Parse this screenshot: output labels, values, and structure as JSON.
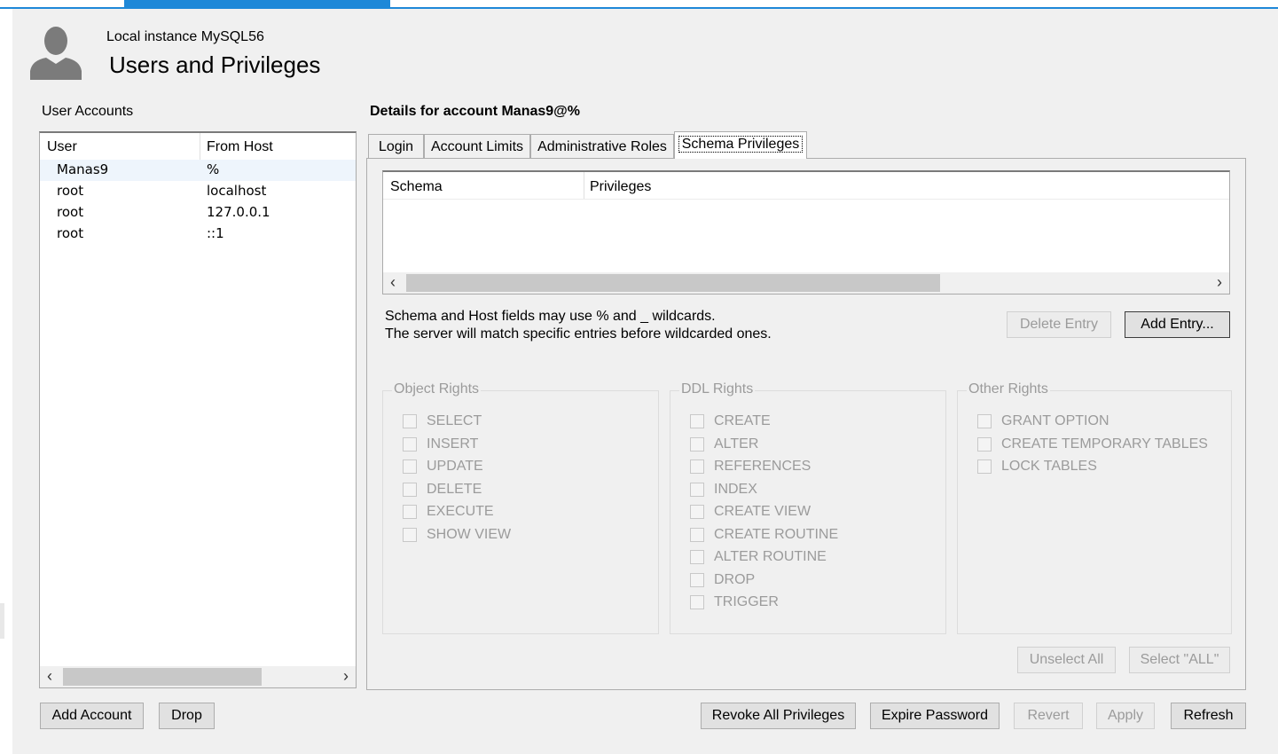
{
  "header": {
    "subtitle": "Local instance MySQL56",
    "title": "Users and Privileges"
  },
  "user_accounts": {
    "label": "User Accounts",
    "columns": [
      "User",
      "From Host"
    ],
    "rows": [
      {
        "user": "Manas9",
        "host": "%",
        "selected": true
      },
      {
        "user": "root",
        "host": "localhost"
      },
      {
        "user": "root",
        "host": "127.0.0.1"
      },
      {
        "user": "root",
        "host": "::1"
      }
    ]
  },
  "details": {
    "label": "Details for account Manas9@%",
    "tabs": [
      "Login",
      "Account Limits",
      "Administrative Roles",
      "Schema Privileges"
    ],
    "active_tab": "Schema Privileges"
  },
  "schema_privileges": {
    "columns": [
      "Schema",
      "Privileges"
    ],
    "help_line1": "Schema and Host fields may use % and _ wildcards.",
    "help_line2": "The server will match specific entries before wildcarded ones.",
    "delete_entry": "Delete Entry",
    "add_entry": "Add Entry...",
    "object_rights": {
      "label": "Object Rights",
      "items": [
        "SELECT",
        "INSERT",
        "UPDATE",
        "DELETE",
        "EXECUTE",
        "SHOW VIEW"
      ]
    },
    "ddl_rights": {
      "label": "DDL Rights",
      "items": [
        "CREATE",
        "ALTER",
        "REFERENCES",
        "INDEX",
        "CREATE VIEW",
        "CREATE ROUTINE",
        "ALTER ROUTINE",
        "DROP",
        "TRIGGER"
      ]
    },
    "other_rights": {
      "label": "Other Rights",
      "items": [
        "GRANT OPTION",
        "CREATE TEMPORARY TABLES",
        "LOCK TABLES"
      ]
    },
    "unselect_all": "Unselect All",
    "select_all": "Select \"ALL\""
  },
  "footer": {
    "add_account": "Add Account",
    "drop": "Drop",
    "revoke_all": "Revoke All Privileges",
    "expire_password": "Expire Password",
    "revert": "Revert",
    "apply": "Apply",
    "refresh": "Refresh"
  },
  "colors": {
    "accent": "#1e88d8",
    "panel_bg": "#f0f0f0",
    "disabled_text": "#9b9b9b"
  }
}
